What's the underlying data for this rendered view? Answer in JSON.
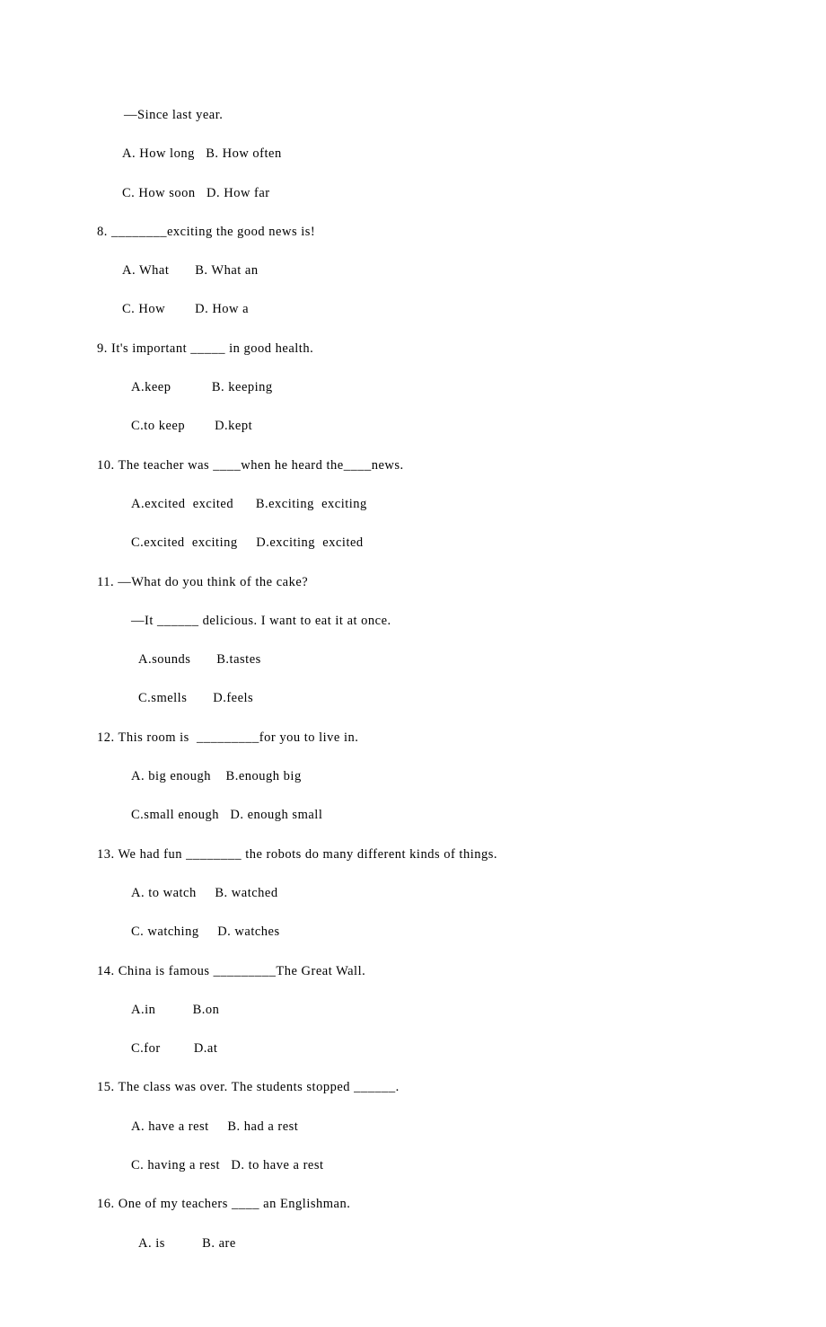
{
  "lines": [
    "—Since last year.",
    "A. How long   B. How often",
    "C. How soon   D. How far",
    "8. ________exciting the good news is!",
    "A. What       B. What an",
    "C. How        D. How a",
    "9. It's important _____ in good health.",
    "A.keep           B. keeping",
    "C.to keep        D.kept",
    "10. The teacher was ____when he heard the____news.",
    "A.excited  excited      B.exciting  exciting",
    "C.excited  exciting     D.exciting  excited",
    "11. —What do you think of the cake?",
    "—It ______ delicious. I want to eat it at once.",
    "A.sounds       B.tastes",
    "C.smells       D.feels",
    "12. This room is  _________for you to live in.",
    "A. big enough    B.enough big",
    "C.small enough   D. enough small",
    "13. We had fun ________ the robots do many different kinds of things.",
    "A. to watch     B. watched",
    "C. watching     D. watches",
    "14. China is famous _________The Great Wall.",
    "A.in          B.on",
    "C.for         D.at",
    "15. The class was over. The students stopped ______.",
    "A. have a rest     B. had a rest",
    "C. having a rest   D. to have a rest",
    "16. One of my teachers ____ an Englishman.",
    "A. is          B. are"
  ],
  "indents": [
    "q-first",
    "opt-row",
    "opt-row",
    "",
    "opt-row",
    "opt-row",
    "",
    "opt-row2",
    "opt-row2",
    "",
    "opt-row2",
    "opt-row2",
    "",
    "opt-row2",
    "opt-row3",
    "opt-row3",
    "",
    "opt-row2",
    "opt-row2",
    "",
    "opt-row2",
    "opt-row2",
    "",
    "opt-row2",
    "opt-row2",
    "",
    "opt-row2",
    "opt-row2",
    "",
    "opt-row3"
  ]
}
